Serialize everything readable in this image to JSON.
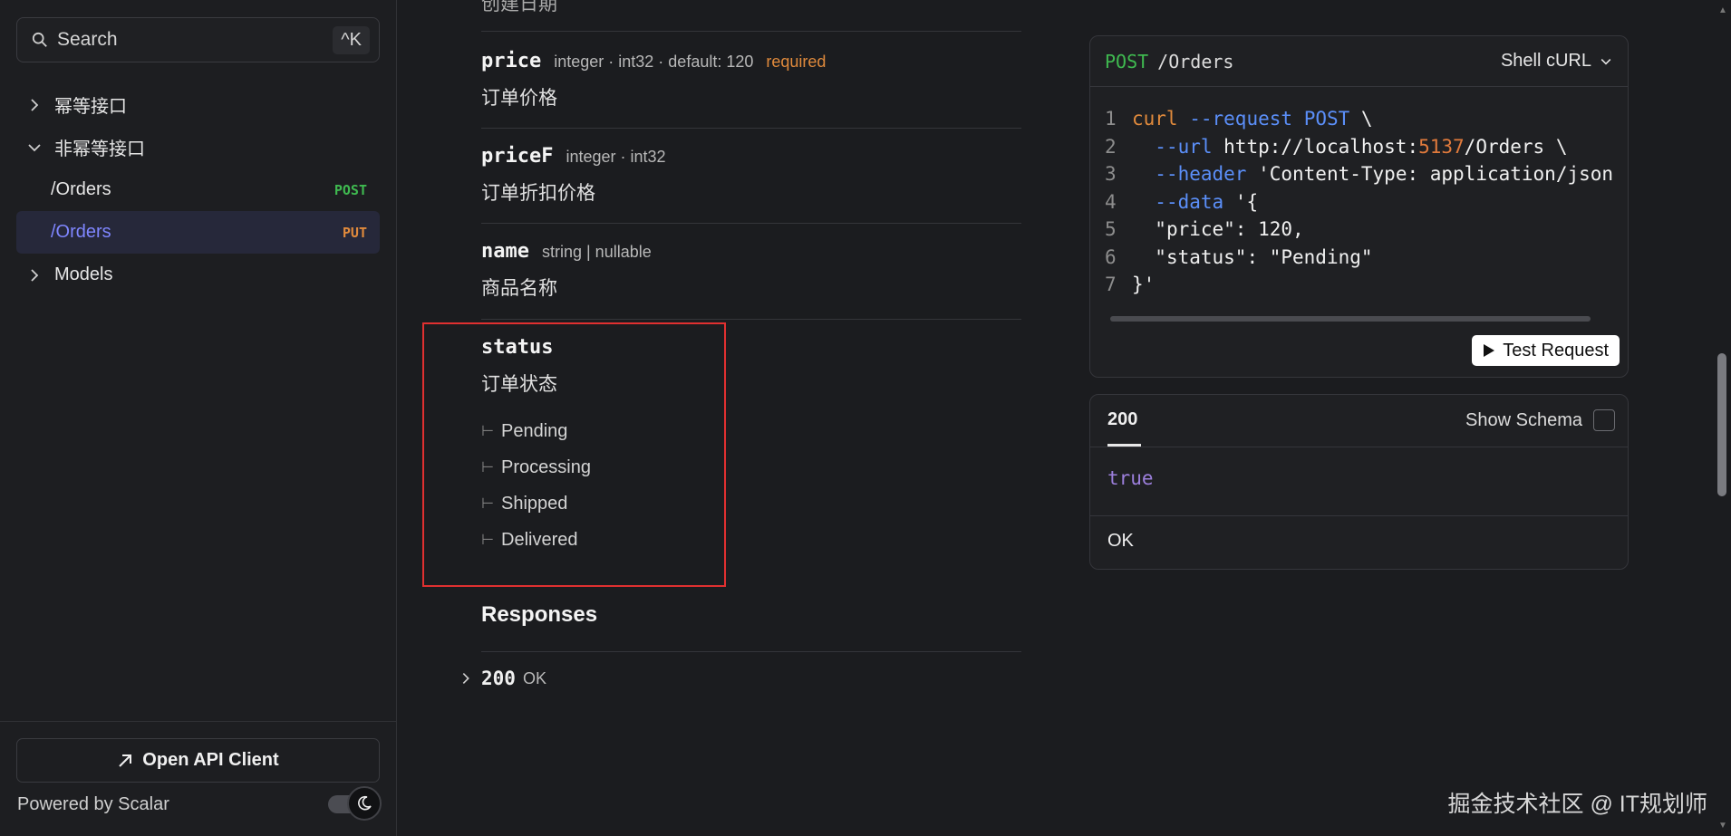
{
  "sidebar": {
    "search_label": "Search",
    "search_shortcut": "^K",
    "groups": [
      {
        "label": "幂等接口",
        "expanded": false
      },
      {
        "label": "非幂等接口",
        "expanded": true
      },
      {
        "label": "Models",
        "expanded": false
      }
    ],
    "endpoints": [
      {
        "path": "/Orders",
        "method": "POST",
        "method_color": "#3fb950"
      },
      {
        "path": "/Orders",
        "method": "PUT",
        "method_color": "#e08a3c"
      }
    ],
    "open_api_client": "Open API Client",
    "powered_by": "Powered by Scalar"
  },
  "params": {
    "cut_off_text": "创建日期",
    "price": {
      "name": "price",
      "meta": "integer · int32 · default: 120",
      "required": "required",
      "desc": "订单价格"
    },
    "priceF": {
      "name": "priceF",
      "meta": "integer · int32",
      "desc": "订单折扣价格"
    },
    "name": {
      "name": "name",
      "meta": "string | nullable",
      "desc": "商品名称"
    },
    "status": {
      "name": "status",
      "desc": "订单状态",
      "enum": [
        "Pending",
        "Processing",
        "Shipped",
        "Delivered"
      ]
    }
  },
  "responses": {
    "title": "Responses",
    "code": "200",
    "label": "OK"
  },
  "request_example": {
    "method": "POST",
    "path": "/Orders",
    "language": "Shell cURL",
    "line_numbers": [
      "1",
      "2",
      "3",
      "4",
      "5",
      "6",
      "7"
    ],
    "code": {
      "l1_cmd": "curl",
      "l1_flag": "--request",
      "l1_method": "POST",
      "l1_tail": " \\",
      "l2_flag": "--url",
      "l2_url_a": " http://localhost:",
      "l2_port": "5137",
      "l2_url_b": "/Orders \\",
      "l3_flag": "--header",
      "l3_str": " 'Content-Type: application/json",
      "l4_flag": "--data",
      "l4_str": " '{",
      "l5_key": "\"price\": ",
      "l5_val": "120",
      "l5_tail": ",",
      "l6_text": "\"status\": \"Pending\"",
      "l7_text": "}'"
    },
    "test_button": "Test Request"
  },
  "response_example": {
    "tab": "200",
    "show_schema": "Show Schema",
    "body": "true",
    "status": "OK"
  },
  "watermark": "掘金技术社区 @ IT规划师"
}
